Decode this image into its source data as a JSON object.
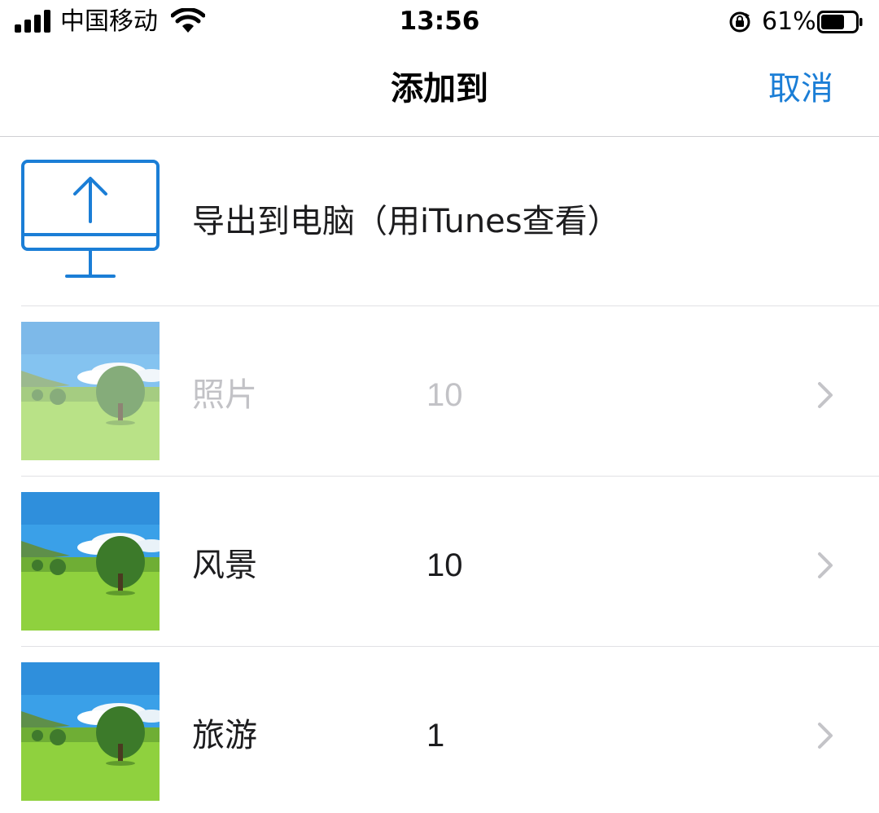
{
  "status_bar": {
    "carrier": "中国移动",
    "time": "13:56",
    "battery_percent": "61%",
    "icons": [
      "signal-icon",
      "wifi-icon",
      "rotation-lock-icon",
      "battery-icon"
    ]
  },
  "nav": {
    "title": "添加到",
    "cancel_label": "取消",
    "accent_color": "#1b7ed6"
  },
  "export": {
    "label": "导出到电脑（用iTunes查看）",
    "icon": "monitor-upload-icon"
  },
  "albums": [
    {
      "name": "照片",
      "count": "10",
      "enabled": false
    },
    {
      "name": "风景",
      "count": "10",
      "enabled": true
    },
    {
      "name": "旅游",
      "count": "1",
      "enabled": true
    }
  ]
}
